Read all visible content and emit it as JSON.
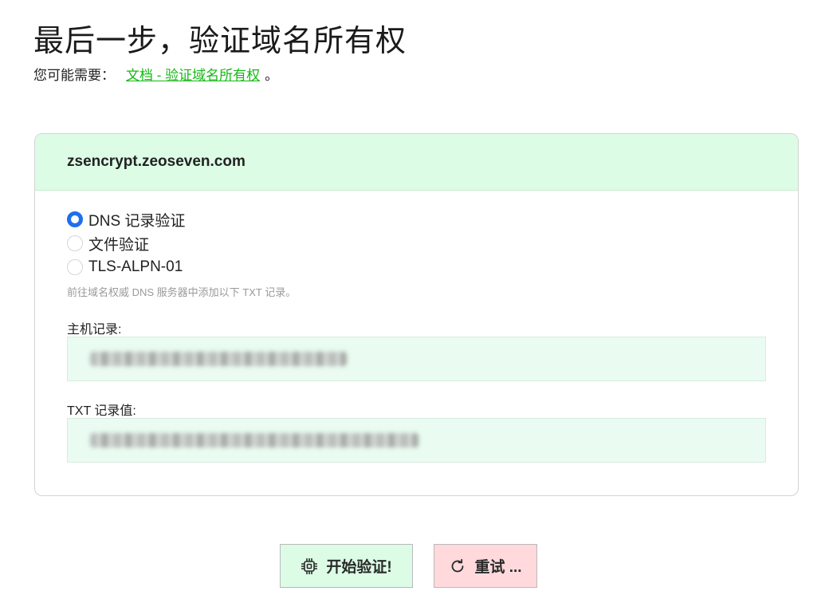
{
  "header": {
    "title": "最后一步，验证域名所有权",
    "hint_prefix": "您可能需要：",
    "doc_link": "文档 - 验证域名所有权",
    "hint_suffix": "。"
  },
  "card": {
    "domain": "zsencrypt.zeoseven.com",
    "options": [
      {
        "label": "DNS 记录验证",
        "selected": true
      },
      {
        "label": "文件验证",
        "selected": false
      },
      {
        "label": "TLS-ALPN-01",
        "selected": false
      }
    ],
    "help_text": "前往域名权威 DNS 服务器中添加以下 TXT 记录。",
    "host_label": "主机记录:",
    "txt_label": "TXT 记录值:"
  },
  "actions": {
    "verify_label": "开始验证!",
    "retry_label": "重试 ..."
  },
  "colors": {
    "accent_green": "#14b814",
    "card_header_bg": "#dcfce6",
    "field_bg": "#eafcf1",
    "radio_blue": "#1f6feb",
    "retry_bg": "#ffd9dc"
  }
}
